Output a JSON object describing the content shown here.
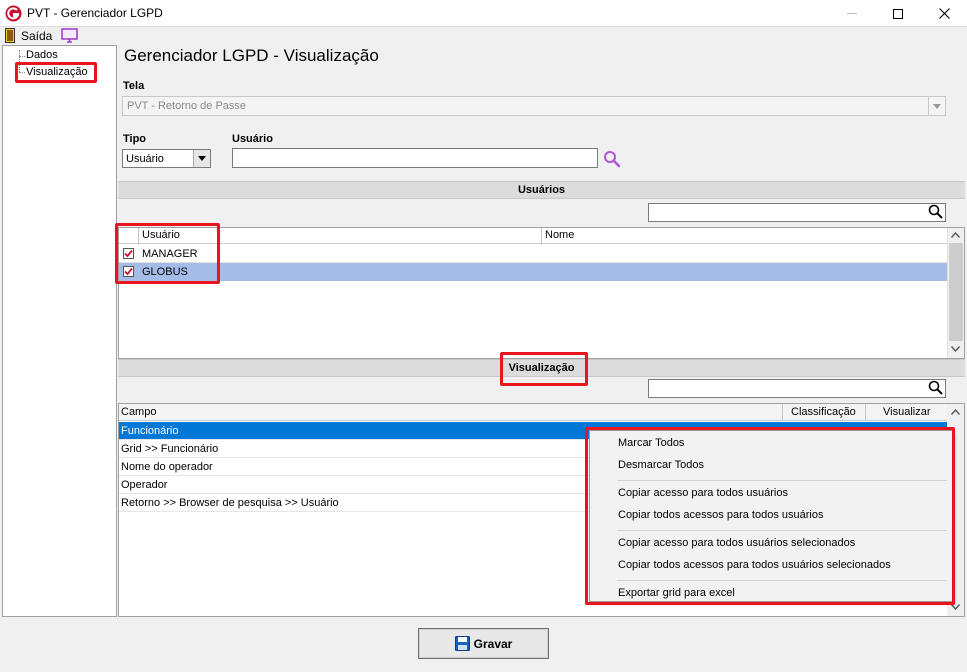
{
  "window": {
    "title": "PVT - Gerenciador LGPD",
    "min_glyph": "—",
    "max_glyph": "☐",
    "close_glyph": "✕"
  },
  "menu": {
    "exit_label": "Saída"
  },
  "nav": {
    "items": [
      {
        "label": "Dados"
      },
      {
        "label": "Visualização",
        "selected": true
      }
    ]
  },
  "page": {
    "title": "Gerenciador LGPD - Visualização"
  },
  "form": {
    "tela_label": "Tela",
    "tela_value": "PVT - Retorno de Passe",
    "tipo_label": "Tipo",
    "tipo_value": "Usuário",
    "usuario_label": "Usuário",
    "usuario_value": ""
  },
  "users_section": {
    "title": "Usuários",
    "search_value": "",
    "columns": [
      "Usuário",
      "Nome"
    ],
    "rows": [
      {
        "checked": true,
        "usuario": "MANAGER",
        "nome": ""
      },
      {
        "checked": true,
        "usuario": "GLOBUS",
        "nome": "",
        "selected": true
      }
    ]
  },
  "fields_section": {
    "title": "Visualização",
    "search_value": "",
    "columns": [
      "Campo",
      "Classificação",
      "Visualizar"
    ],
    "rows": [
      {
        "campo": "Funcionário",
        "selected": true
      },
      {
        "campo": "Grid >> Funcionário"
      },
      {
        "campo": "Nome do operador"
      },
      {
        "campo": "Operador"
      },
      {
        "campo": "Retorno >> Browser de pesquisa >> Usuário"
      }
    ]
  },
  "context_menu": {
    "items": [
      "Marcar Todos",
      "Desmarcar Todos",
      "Copiar acesso para todos usuários",
      "Copiar todos acessos para todos usuários",
      "Copiar acesso para todos usuários selecionados",
      "Copiar todos acessos para todos usuários selecionados",
      "Exportar grid para excel"
    ]
  },
  "buttons": {
    "save_label": "Gravar"
  },
  "colors": {
    "selection_blue": "#0078d7",
    "selected_row": "#a3bde8",
    "highlight_red": "#e8141e",
    "search_icon_purple": "#b056d8"
  },
  "icons": {
    "app": "app-logo-icon",
    "exit": "exit-door-icon",
    "monitor": "monitor-icon",
    "search": "search-icon",
    "save": "floppy-disk-icon"
  }
}
